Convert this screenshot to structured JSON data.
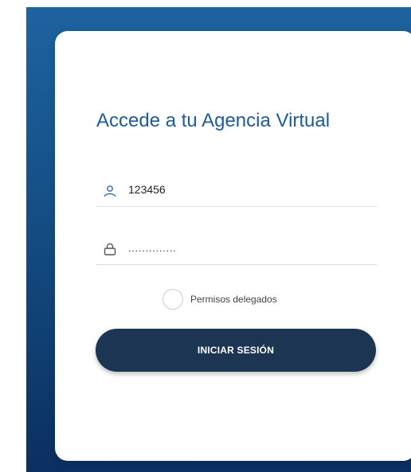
{
  "login": {
    "title": "Accede a tu Agencia Virtual",
    "username": {
      "value": "123456",
      "icon": "user-icon"
    },
    "password": {
      "value": "..............",
      "icon": "lock-icon"
    },
    "delegated_permissions": {
      "label": "Permisos delegados",
      "checked": false
    },
    "submit_label": "INICIAR SESIÓN"
  },
  "colors": {
    "background_top": "#1d63a0",
    "background_bottom": "#0b2f60",
    "title": "#1f5b97",
    "button": "#1b3553",
    "card": "#ffffff"
  }
}
